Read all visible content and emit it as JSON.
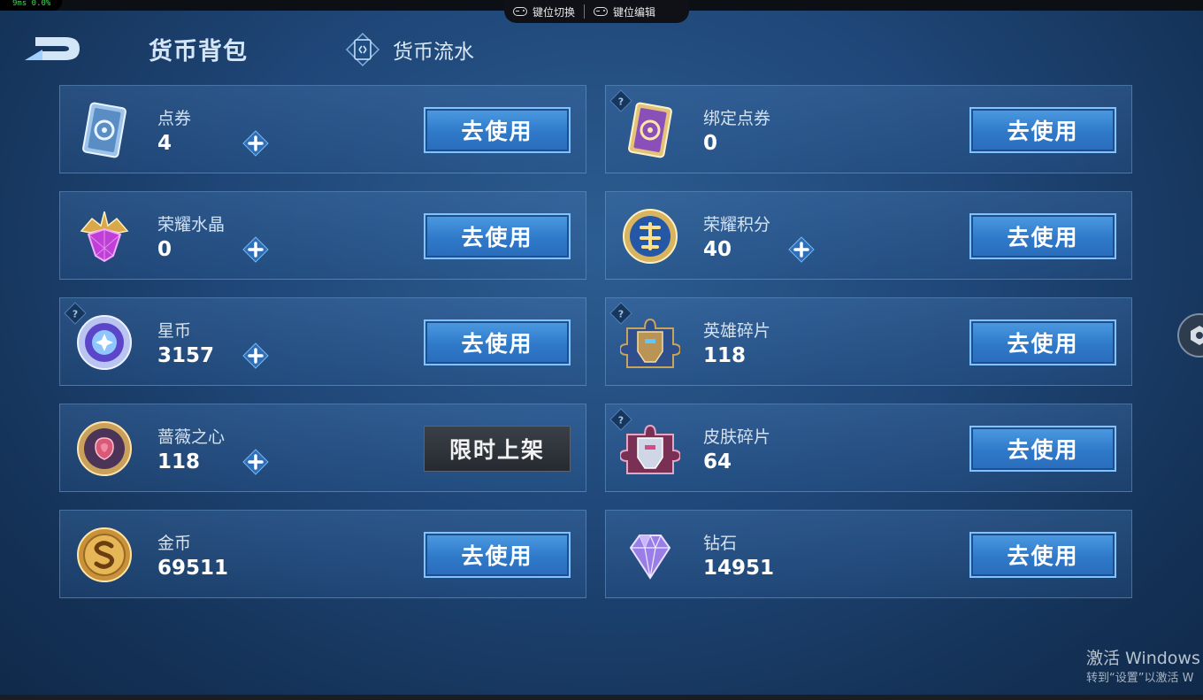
{
  "status": {
    "fps_text": "9ms  0.0%"
  },
  "keybar": {
    "switch_label": "键位切换",
    "edit_label": "键位编辑"
  },
  "header": {
    "title": "货币背包",
    "flow_label": "货币流水"
  },
  "use_label": "去使用",
  "cards": [
    {
      "name": "点券",
      "value": "4",
      "icon": "coupon-ticket-icon",
      "plus": true,
      "help": false,
      "button": "去使用"
    },
    {
      "name": "绑定点券",
      "value": "0",
      "icon": "bound-coupon-ticket-icon",
      "plus": false,
      "help": true,
      "button": "去使用"
    },
    {
      "name": "荣耀水晶",
      "value": "0",
      "icon": "glory-crystal-icon",
      "plus": true,
      "help": false,
      "button": "去使用"
    },
    {
      "name": "荣耀积分",
      "value": "40",
      "icon": "glory-points-icon",
      "plus": true,
      "help": false,
      "button": "去使用"
    },
    {
      "name": "星币",
      "value": "3157",
      "icon": "star-coin-icon",
      "plus": true,
      "help": true,
      "button": "去使用"
    },
    {
      "name": "英雄碎片",
      "value": "118",
      "icon": "hero-fragment-icon",
      "plus": false,
      "help": true,
      "button": "去使用"
    },
    {
      "name": "蔷薇之心",
      "value": "118",
      "icon": "rose-heart-icon",
      "plus": true,
      "help": false,
      "button": "限时上架"
    },
    {
      "name": "皮肤碎片",
      "value": "64",
      "icon": "skin-fragment-icon",
      "plus": false,
      "help": true,
      "button": "去使用"
    },
    {
      "name": "金币",
      "value": "69511",
      "icon": "gold-coin-icon",
      "plus": false,
      "help": false,
      "button": "去使用"
    },
    {
      "name": "钻石",
      "value": "14951",
      "icon": "diamond-icon",
      "plus": false,
      "help": false,
      "button": "去使用"
    }
  ],
  "watermark": {
    "line1": "激活 Windows",
    "line2": "转到“设置”以激活 W"
  },
  "colors": {
    "accent_button": "#3a88d6",
    "background": "#1f4677",
    "limited_button": "#2f343b"
  }
}
